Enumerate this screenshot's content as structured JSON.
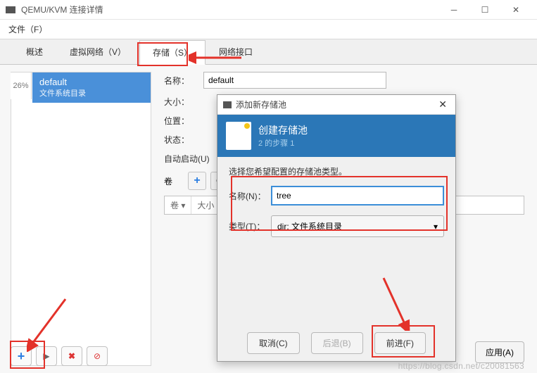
{
  "window": {
    "title": "QEMU/KVM 连接详情",
    "menu_file": "文件（F）",
    "tab_overview": "概述",
    "tab_virtnet": "虚拟网络（V）",
    "tab_storage": "存储（S）",
    "tab_netif": "网络接口"
  },
  "sidebar": {
    "pool_name": "default",
    "pool_sub": "文件系统目录",
    "usage_pct": "26%"
  },
  "details": {
    "label_name": "名称：",
    "value_name": "default",
    "label_size": "大小：",
    "label_location": "位置：",
    "label_status": "状态：",
    "label_autostart": "自动启动(U)",
    "label_volumes": "卷",
    "col_vol": "卷 ▾",
    "col_size": "大小"
  },
  "modal": {
    "title": "添加新存储池",
    "header_title": "创建存储池",
    "header_sub": "2 的步骤 1",
    "hint": "选择您希望配置的存储池类型。",
    "label_name": "名称(N)：",
    "input_name": "tree",
    "label_type": "类型(T)：",
    "type_value": "dir: 文件系统目录",
    "btn_cancel": "取消(C)",
    "btn_back": "后退(B)",
    "btn_forward": "前进(F)"
  },
  "footer": {
    "btn_apply": "应用(A)"
  },
  "watermark": "https://blog.csdn.net/c20081563"
}
